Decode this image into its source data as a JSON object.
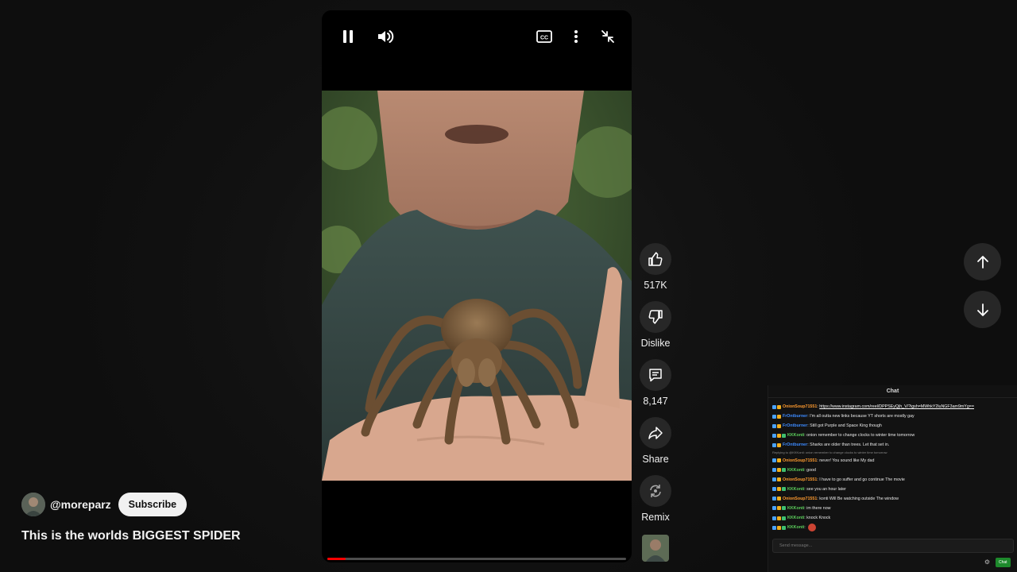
{
  "player": {
    "controls": {
      "pause_icon": "pause-icon",
      "volume_icon": "volume-icon",
      "captions_icon": "closed-captions-icon",
      "more_icon": "more-vertical-icon",
      "exit_fullscreen_icon": "collapse-icon"
    },
    "progress": 0.06
  },
  "actions": {
    "like": {
      "label": "517K",
      "icon": "thumbs-up-icon"
    },
    "dislike": {
      "label": "Dislike",
      "icon": "thumbs-down-icon"
    },
    "comments": {
      "label": "8,147",
      "icon": "comment-icon"
    },
    "share": {
      "label": "Share",
      "icon": "share-icon"
    },
    "remix": {
      "label": "Remix",
      "icon": "remix-icon"
    }
  },
  "channel": {
    "name": "@moreparz",
    "subscribe_label": "Subscribe"
  },
  "video": {
    "title": "This is the worlds BIGGEST SPIDER"
  },
  "navigation": {
    "up_icon": "arrow-up-icon",
    "down_icon": "arrow-down-icon"
  },
  "chat": {
    "title": "Chat",
    "input_placeholder": "Send message...",
    "send_label": "Chat",
    "colors": {
      "onion": "#ff9b2f",
      "fro": "#3d8bff",
      "kk": "#5dd15d"
    },
    "messages": [
      {
        "user": "OnionSoup71551",
        "color": "#ff9b2f",
        "sep": ": ",
        "text": "https://www.instagram.com/reel/DPPSEyQjh_V/?igsh=MWhkY2luNGF3am9mYg==",
        "link": true
      },
      {
        "user": "FrOntburner",
        "color": "#3d8bff",
        "sep": ": ",
        "text": "I'm all outta new links because YT shorts are mostly gay"
      },
      {
        "user": "FrOntburner",
        "color": "#3d8bff",
        "sep": ": ",
        "text": "Still got Purple and Space King though"
      },
      {
        "user": "KKKonti",
        "color": "#5dd15d",
        "sep": ": ",
        "text": "onion remember to change clocks to winter time tomorrow"
      },
      {
        "user": "FrOntburner",
        "color": "#3d8bff",
        "sep": ": ",
        "text": "Sharks are older than trees. Let that set in."
      },
      {
        "reply": "Replying to @KKKonti: onion remember to change clocks to winter time tomorrow"
      },
      {
        "user": "OnionSoup71551",
        "color": "#ff9b2f",
        "sep": ": ",
        "text": "never! You sound like My dad"
      },
      {
        "user": "KKKonti",
        "color": "#5dd15d",
        "sep": ": ",
        "text": "good"
      },
      {
        "user": "OnionSoup71551",
        "color": "#ff9b2f",
        "sep": ": ",
        "text": "I have to go suffer and go continue The movie"
      },
      {
        "user": "KKKonti",
        "color": "#5dd15d",
        "sep": ": ",
        "text": "see you an hour later"
      },
      {
        "user": "OnionSoup71551",
        "color": "#ff9b2f",
        "sep": ": ",
        "text": "konti Will Be watching outside The window"
      },
      {
        "user": "KKKonti",
        "color": "#5dd15d",
        "sep": ": ",
        "text": "im there now"
      },
      {
        "user": "KKKonti",
        "color": "#5dd15d",
        "sep": ": ",
        "text": "knock Knock"
      },
      {
        "user": "KKKonti",
        "color": "#5dd15d",
        "sep": ": ",
        "text": "",
        "emote": "devil-emote"
      }
    ]
  }
}
